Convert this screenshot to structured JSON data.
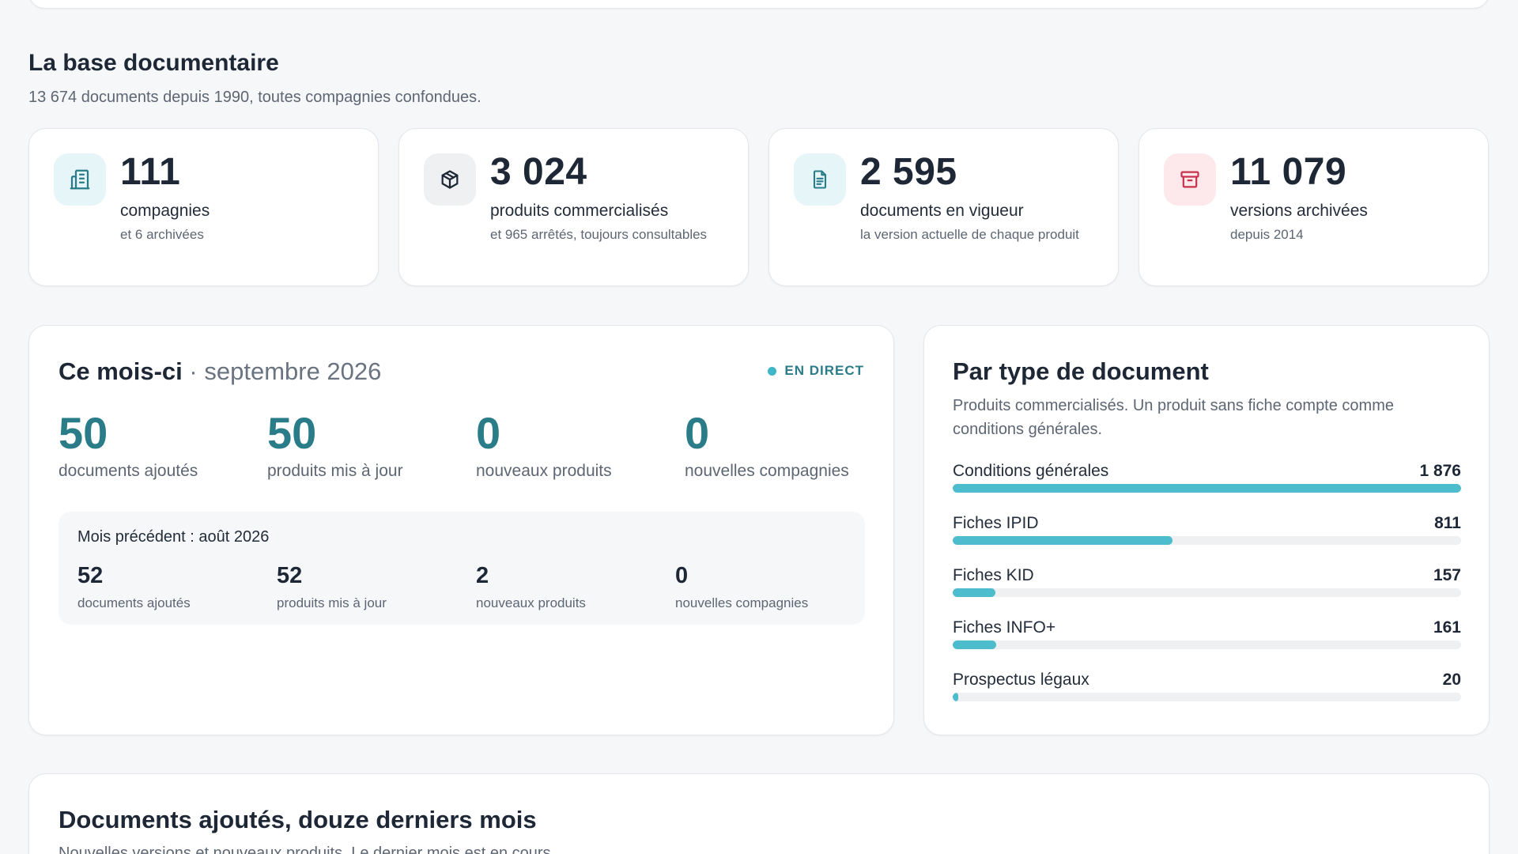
{
  "overview": {
    "title": "La base documentaire",
    "subtitle": "13 674 documents depuis 1990, toutes compagnies confondues."
  },
  "stats": [
    {
      "icon": "building-icon",
      "value": "111",
      "label": "compagnies",
      "note": "et 6 archivées",
      "icon_bg": "#e6f5f7",
      "icon_color": "#2a7c88"
    },
    {
      "icon": "package-icon",
      "value": "3 024",
      "label": "produits commercialisés",
      "note": "et 965 arrêtés, toujours consultables",
      "icon_bg": "#eef0f2",
      "icon_color": "#1d2735"
    },
    {
      "icon": "document-icon",
      "value": "2 595",
      "label": "documents en vigueur",
      "note": "la version actuelle de chaque produit",
      "icon_bg": "#e6f5f7",
      "icon_color": "#2a7c88"
    },
    {
      "icon": "archive-icon",
      "value": "11 079",
      "label": "versions archivées",
      "note": "depuis 2014",
      "icon_bg": "#fde8ec",
      "icon_color": "#c8324d"
    }
  ],
  "month": {
    "title": "Ce mois-ci",
    "separator": "·",
    "period": "septembre 2026",
    "live_label": "EN DIRECT",
    "stats": [
      {
        "value": "50",
        "label": "documents ajoutés"
      },
      {
        "value": "50",
        "label": "produits mis à jour"
      },
      {
        "value": "0",
        "label": "nouveaux produits"
      },
      {
        "value": "0",
        "label": "nouvelles compagnies"
      }
    ],
    "previous": {
      "title": "Mois précédent : août 2026",
      "stats": [
        {
          "value": "52",
          "label": "documents ajoutés"
        },
        {
          "value": "52",
          "label": "produits mis à jour"
        },
        {
          "value": "2",
          "label": "nouveaux produits"
        },
        {
          "value": "0",
          "label": "nouvelles compagnies"
        }
      ]
    }
  },
  "types": {
    "title": "Par type de document",
    "subtitle": "Produits commercialisés. Un produit sans fiche compte comme conditions générales.",
    "items": [
      {
        "name": "Conditions générales",
        "value_label": "1 876",
        "value": 1876
      },
      {
        "name": "Fiches IPID",
        "value_label": "811",
        "value": 811
      },
      {
        "name": "Fiches KID",
        "value_label": "157",
        "value": 157
      },
      {
        "name": "Fiches INFO+",
        "value_label": "161",
        "value": 161
      },
      {
        "name": "Prospectus légaux",
        "value_label": "20",
        "value": 20
      }
    ],
    "bar_color": "#4dbccc"
  },
  "chart_section": {
    "title": "Documents ajoutés, douze derniers mois",
    "subtitle": "Nouvelles versions et nouveaux produits. Le dernier mois est en cours."
  },
  "colors": {
    "accent": "#2a7c88",
    "live_dot": "#3fb5c8",
    "archive": "#c8324d"
  }
}
